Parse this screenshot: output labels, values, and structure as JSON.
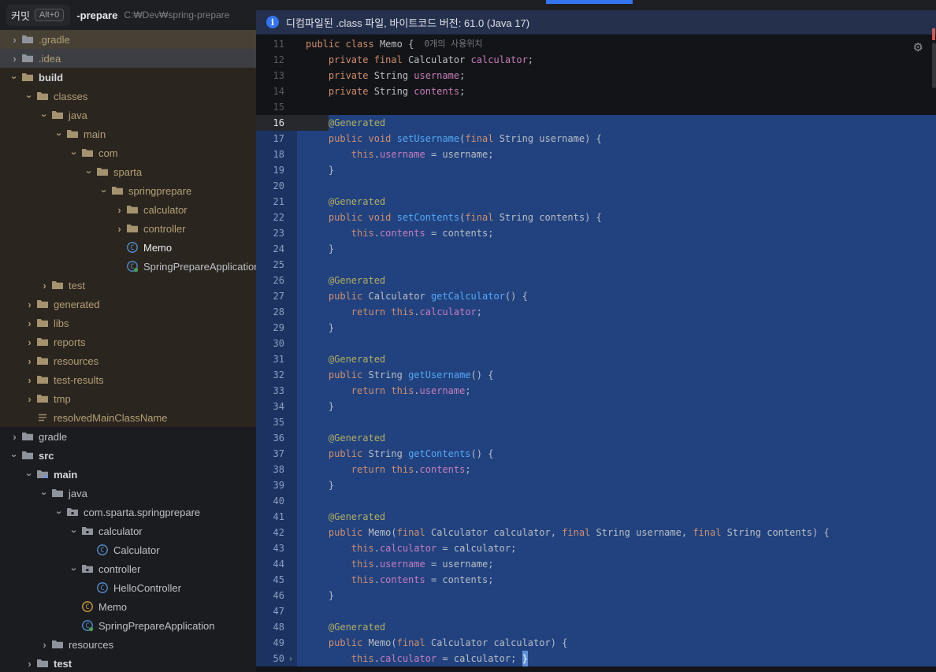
{
  "window": {
    "commit_tab": "커밋",
    "commit_shortcut": "Alt+0",
    "project_name": "-prepare",
    "project_path": "C:₩Dev₩spring-prepare"
  },
  "banner": {
    "icon": "info",
    "text": "디컴파일된 .class 파일, 바이트코드 버전: 61.0 (Java 17)"
  },
  "colors": {
    "accent_blue": "#3574f0",
    "selection_blue": "#21427f",
    "error_stripe": "#cf5b56",
    "banner_bg": "#25304d",
    "zone_brown": "#2b251f"
  },
  "project_tree": {
    "items": [
      {
        "label": ".gradle",
        "level": 0,
        "chevron": "right",
        "icon": "folder",
        "row": "tan",
        "tan": true
      },
      {
        "label": ".idea",
        "level": 0,
        "chevron": "right",
        "icon": "folder",
        "row": "gray",
        "tan": true
      },
      {
        "label": "build",
        "level": 0,
        "chevron": "down",
        "icon": "folder",
        "bold": true,
        "zone": true,
        "tan": true
      },
      {
        "label": "classes",
        "level": 1,
        "chevron": "down",
        "icon": "folder",
        "zone": true,
        "tan": true
      },
      {
        "label": "java",
        "level": 2,
        "chevron": "down",
        "icon": "folder",
        "zone": true,
        "tan": true
      },
      {
        "label": "main",
        "level": 3,
        "chevron": "down",
        "icon": "folder",
        "zone": true,
        "tan": true
      },
      {
        "label": "com",
        "level": 4,
        "chevron": "down",
        "icon": "folder",
        "zone": true,
        "tan": true
      },
      {
        "label": "sparta",
        "level": 5,
        "chevron": "down",
        "icon": "folder",
        "zone": true,
        "tan": true
      },
      {
        "label": "springprepare",
        "level": 6,
        "chevron": "down",
        "icon": "folder",
        "zone": true,
        "tan": true
      },
      {
        "label": "calculator",
        "level": 7,
        "chevron": "right",
        "icon": "folder",
        "zone": true,
        "tan": true
      },
      {
        "label": "controller",
        "level": 7,
        "chevron": "right",
        "icon": "folder",
        "zone": true,
        "tan": true
      },
      {
        "label": "Memo",
        "level": 7,
        "chevron": "none",
        "icon": "class",
        "zone": true,
        "row": "selected"
      },
      {
        "label": "SpringPrepareApplication",
        "level": 7,
        "chevron": "none",
        "icon": "class-spring",
        "zone": true
      },
      {
        "label": "test",
        "level": 2,
        "chevron": "right",
        "icon": "folder",
        "zone": true,
        "tan": true
      },
      {
        "label": "generated",
        "level": 1,
        "chevron": "right",
        "icon": "folder",
        "zone": true,
        "tan": true
      },
      {
        "label": "libs",
        "level": 1,
        "chevron": "right",
        "icon": "folder",
        "zone": true,
        "tan": true
      },
      {
        "label": "reports",
        "level": 1,
        "chevron": "right",
        "icon": "folder",
        "zone": true,
        "tan": true
      },
      {
        "label": "resources",
        "level": 1,
        "chevron": "right",
        "icon": "folder",
        "zone": true,
        "tan": true
      },
      {
        "label": "test-results",
        "level": 1,
        "chevron": "right",
        "icon": "folder",
        "zone": true,
        "tan": true
      },
      {
        "label": "tmp",
        "level": 1,
        "chevron": "right",
        "icon": "folder",
        "zone": true,
        "tan": true
      },
      {
        "label": "resolvedMainClassName",
        "level": 1,
        "chevron": "none",
        "icon": "file",
        "zone": true,
        "tan": true
      },
      {
        "label": "gradle",
        "level": 0,
        "chevron": "right",
        "icon": "folder"
      },
      {
        "label": "src",
        "level": 0,
        "chevron": "down",
        "icon": "folder",
        "bold": true
      },
      {
        "label": "main",
        "level": 1,
        "chevron": "down",
        "icon": "source-folder",
        "bold": true
      },
      {
        "label": "java",
        "level": 2,
        "chevron": "down",
        "icon": "folder"
      },
      {
        "label": "com.sparta.springprepare",
        "level": 3,
        "chevron": "down",
        "icon": "package"
      },
      {
        "label": "calculator",
        "level": 4,
        "chevron": "down",
        "icon": "package"
      },
      {
        "label": "Calculator",
        "level": 5,
        "chevron": "none",
        "icon": "class"
      },
      {
        "label": "controller",
        "level": 4,
        "chevron": "down",
        "icon": "package"
      },
      {
        "label": "HelloController",
        "level": 5,
        "chevron": "none",
        "icon": "class"
      },
      {
        "label": "Memo",
        "level": 4,
        "chevron": "none",
        "icon": "class-orange"
      },
      {
        "label": "SpringPrepareApplication",
        "level": 4,
        "chevron": "none",
        "icon": "class-spring"
      },
      {
        "label": "resources",
        "level": 2,
        "chevron": "right",
        "icon": "folder"
      },
      {
        "label": "test",
        "level": 1,
        "chevron": "right",
        "icon": "folder",
        "bold": true
      }
    ]
  },
  "editor": {
    "lines": [
      {
        "n": 11,
        "tokens": [
          [
            "kw",
            "public"
          ],
          [
            "pl",
            " "
          ],
          [
            "kw",
            "class"
          ],
          [
            "pl",
            " Memo {"
          ],
          [
            "hint",
            "  0개의 사용위치"
          ]
        ]
      },
      {
        "n": 12,
        "tokens": [
          [
            "pl",
            "    "
          ],
          [
            "kw",
            "private"
          ],
          [
            "pl",
            " "
          ],
          [
            "kw",
            "final"
          ],
          [
            "pl",
            " Calculator "
          ],
          [
            "fd",
            "calculator"
          ],
          [
            "pl",
            ";"
          ]
        ]
      },
      {
        "n": 13,
        "tokens": [
          [
            "pl",
            "    "
          ],
          [
            "kw",
            "private"
          ],
          [
            "pl",
            " String "
          ],
          [
            "fd",
            "username"
          ],
          [
            "pl",
            ";"
          ]
        ]
      },
      {
        "n": 14,
        "tokens": [
          [
            "pl",
            "    "
          ],
          [
            "kw",
            "private"
          ],
          [
            "pl",
            " String "
          ],
          [
            "fd",
            "contents"
          ],
          [
            "pl",
            ";"
          ]
        ]
      },
      {
        "n": 15,
        "tokens": []
      },
      {
        "n": 16,
        "sel": true,
        "caret": true,
        "selStart": 4,
        "tokens": [
          [
            "an",
            "@Generated"
          ]
        ]
      },
      {
        "n": 17,
        "sel": true,
        "tokens": [
          [
            "pl",
            "    "
          ],
          [
            "kw",
            "public"
          ],
          [
            "pl",
            " "
          ],
          [
            "kw",
            "void"
          ],
          [
            "pl",
            " "
          ],
          [
            "mt",
            "setUsername"
          ],
          [
            "pl",
            "("
          ],
          [
            "kw",
            "final"
          ],
          [
            "pl",
            " String username) {"
          ]
        ]
      },
      {
        "n": 18,
        "sel": true,
        "tokens": [
          [
            "pl",
            "        "
          ],
          [
            "kw",
            "this"
          ],
          [
            "pl",
            "."
          ],
          [
            "fd",
            "username"
          ],
          [
            "pl",
            " = username;"
          ]
        ]
      },
      {
        "n": 19,
        "sel": true,
        "tokens": [
          [
            "pl",
            "    }"
          ]
        ]
      },
      {
        "n": 20,
        "sel": true,
        "tokens": []
      },
      {
        "n": 21,
        "sel": true,
        "tokens": [
          [
            "pl",
            "    "
          ],
          [
            "an",
            "@Generated"
          ]
        ]
      },
      {
        "n": 22,
        "sel": true,
        "tokens": [
          [
            "pl",
            "    "
          ],
          [
            "kw",
            "public"
          ],
          [
            "pl",
            " "
          ],
          [
            "kw",
            "void"
          ],
          [
            "pl",
            " "
          ],
          [
            "mt",
            "setContents"
          ],
          [
            "pl",
            "("
          ],
          [
            "kw",
            "final"
          ],
          [
            "pl",
            " String contents) {"
          ]
        ]
      },
      {
        "n": 23,
        "sel": true,
        "tokens": [
          [
            "pl",
            "        "
          ],
          [
            "kw",
            "this"
          ],
          [
            "pl",
            "."
          ],
          [
            "fd",
            "contents"
          ],
          [
            "pl",
            " = contents;"
          ]
        ]
      },
      {
        "n": 24,
        "sel": true,
        "tokens": [
          [
            "pl",
            "    }"
          ]
        ]
      },
      {
        "n": 25,
        "sel": true,
        "tokens": []
      },
      {
        "n": 26,
        "sel": true,
        "tokens": [
          [
            "pl",
            "    "
          ],
          [
            "an",
            "@Generated"
          ]
        ]
      },
      {
        "n": 27,
        "sel": true,
        "tokens": [
          [
            "pl",
            "    "
          ],
          [
            "kw",
            "public"
          ],
          [
            "pl",
            " Calculator "
          ],
          [
            "mt",
            "getCalculator"
          ],
          [
            "pl",
            "() {"
          ]
        ]
      },
      {
        "n": 28,
        "sel": true,
        "tokens": [
          [
            "pl",
            "        "
          ],
          [
            "kw",
            "return"
          ],
          [
            "pl",
            " "
          ],
          [
            "kw",
            "this"
          ],
          [
            "pl",
            "."
          ],
          [
            "fd",
            "calculator"
          ],
          [
            "pl",
            ";"
          ]
        ]
      },
      {
        "n": 29,
        "sel": true,
        "tokens": [
          [
            "pl",
            "    }"
          ]
        ]
      },
      {
        "n": 30,
        "sel": true,
        "tokens": []
      },
      {
        "n": 31,
        "sel": true,
        "tokens": [
          [
            "pl",
            "    "
          ],
          [
            "an",
            "@Generated"
          ]
        ]
      },
      {
        "n": 32,
        "sel": true,
        "tokens": [
          [
            "pl",
            "    "
          ],
          [
            "kw",
            "public"
          ],
          [
            "pl",
            " String "
          ],
          [
            "mt",
            "getUsername"
          ],
          [
            "pl",
            "() {"
          ]
        ]
      },
      {
        "n": 33,
        "sel": true,
        "tokens": [
          [
            "pl",
            "        "
          ],
          [
            "kw",
            "return"
          ],
          [
            "pl",
            " "
          ],
          [
            "kw",
            "this"
          ],
          [
            "pl",
            "."
          ],
          [
            "fd",
            "username"
          ],
          [
            "pl",
            ";"
          ]
        ]
      },
      {
        "n": 34,
        "sel": true,
        "tokens": [
          [
            "pl",
            "    }"
          ]
        ]
      },
      {
        "n": 35,
        "sel": true,
        "tokens": []
      },
      {
        "n": 36,
        "sel": true,
        "tokens": [
          [
            "pl",
            "    "
          ],
          [
            "an",
            "@Generated"
          ]
        ]
      },
      {
        "n": 37,
        "sel": true,
        "tokens": [
          [
            "pl",
            "    "
          ],
          [
            "kw",
            "public"
          ],
          [
            "pl",
            " String "
          ],
          [
            "mt",
            "getContents"
          ],
          [
            "pl",
            "() {"
          ]
        ]
      },
      {
        "n": 38,
        "sel": true,
        "tokens": [
          [
            "pl",
            "        "
          ],
          [
            "kw",
            "return"
          ],
          [
            "pl",
            " "
          ],
          [
            "kw",
            "this"
          ],
          [
            "pl",
            "."
          ],
          [
            "fd",
            "contents"
          ],
          [
            "pl",
            ";"
          ]
        ]
      },
      {
        "n": 39,
        "sel": true,
        "tokens": [
          [
            "pl",
            "    }"
          ]
        ]
      },
      {
        "n": 40,
        "sel": true,
        "tokens": []
      },
      {
        "n": 41,
        "sel": true,
        "tokens": [
          [
            "pl",
            "    "
          ],
          [
            "an",
            "@Generated"
          ]
        ]
      },
      {
        "n": 42,
        "sel": true,
        "tokens": [
          [
            "pl",
            "    "
          ],
          [
            "kw",
            "public"
          ],
          [
            "pl",
            " Memo("
          ],
          [
            "kw",
            "final"
          ],
          [
            "pl",
            " Calculator calculator, "
          ],
          [
            "kw",
            "final"
          ],
          [
            "pl",
            " String username, "
          ],
          [
            "kw",
            "final"
          ],
          [
            "pl",
            " String contents) {"
          ]
        ]
      },
      {
        "n": 43,
        "sel": true,
        "tokens": [
          [
            "pl",
            "        "
          ],
          [
            "kw",
            "this"
          ],
          [
            "pl",
            "."
          ],
          [
            "fd",
            "calculator"
          ],
          [
            "pl",
            " = calculator;"
          ]
        ]
      },
      {
        "n": 44,
        "sel": true,
        "tokens": [
          [
            "pl",
            "        "
          ],
          [
            "kw",
            "this"
          ],
          [
            "pl",
            "."
          ],
          [
            "fd",
            "username"
          ],
          [
            "pl",
            " = username;"
          ]
        ]
      },
      {
        "n": 45,
        "sel": true,
        "tokens": [
          [
            "pl",
            "        "
          ],
          [
            "kw",
            "this"
          ],
          [
            "pl",
            "."
          ],
          [
            "fd",
            "contents"
          ],
          [
            "pl",
            " = contents;"
          ]
        ]
      },
      {
        "n": 46,
        "sel": true,
        "tokens": [
          [
            "pl",
            "    }"
          ]
        ]
      },
      {
        "n": 47,
        "sel": true,
        "tokens": []
      },
      {
        "n": 48,
        "sel": true,
        "tokens": [
          [
            "pl",
            "    "
          ],
          [
            "an",
            "@Generated"
          ]
        ]
      },
      {
        "n": 49,
        "sel": true,
        "tokens": [
          [
            "pl",
            "    "
          ],
          [
            "kw",
            "public"
          ],
          [
            "pl",
            " Memo("
          ],
          [
            "kw",
            "final"
          ],
          [
            "pl",
            " Calculator calculator) {"
          ]
        ]
      },
      {
        "n": 50,
        "sel": true,
        "fold": "right",
        "tokens": [
          [
            "pl",
            "        "
          ],
          [
            "kw",
            "this"
          ],
          [
            "pl",
            "."
          ],
          [
            "fd",
            "calculator"
          ],
          [
            "pl",
            " = calculator; "
          ],
          [
            "cb",
            "}"
          ]
        ]
      }
    ]
  }
}
